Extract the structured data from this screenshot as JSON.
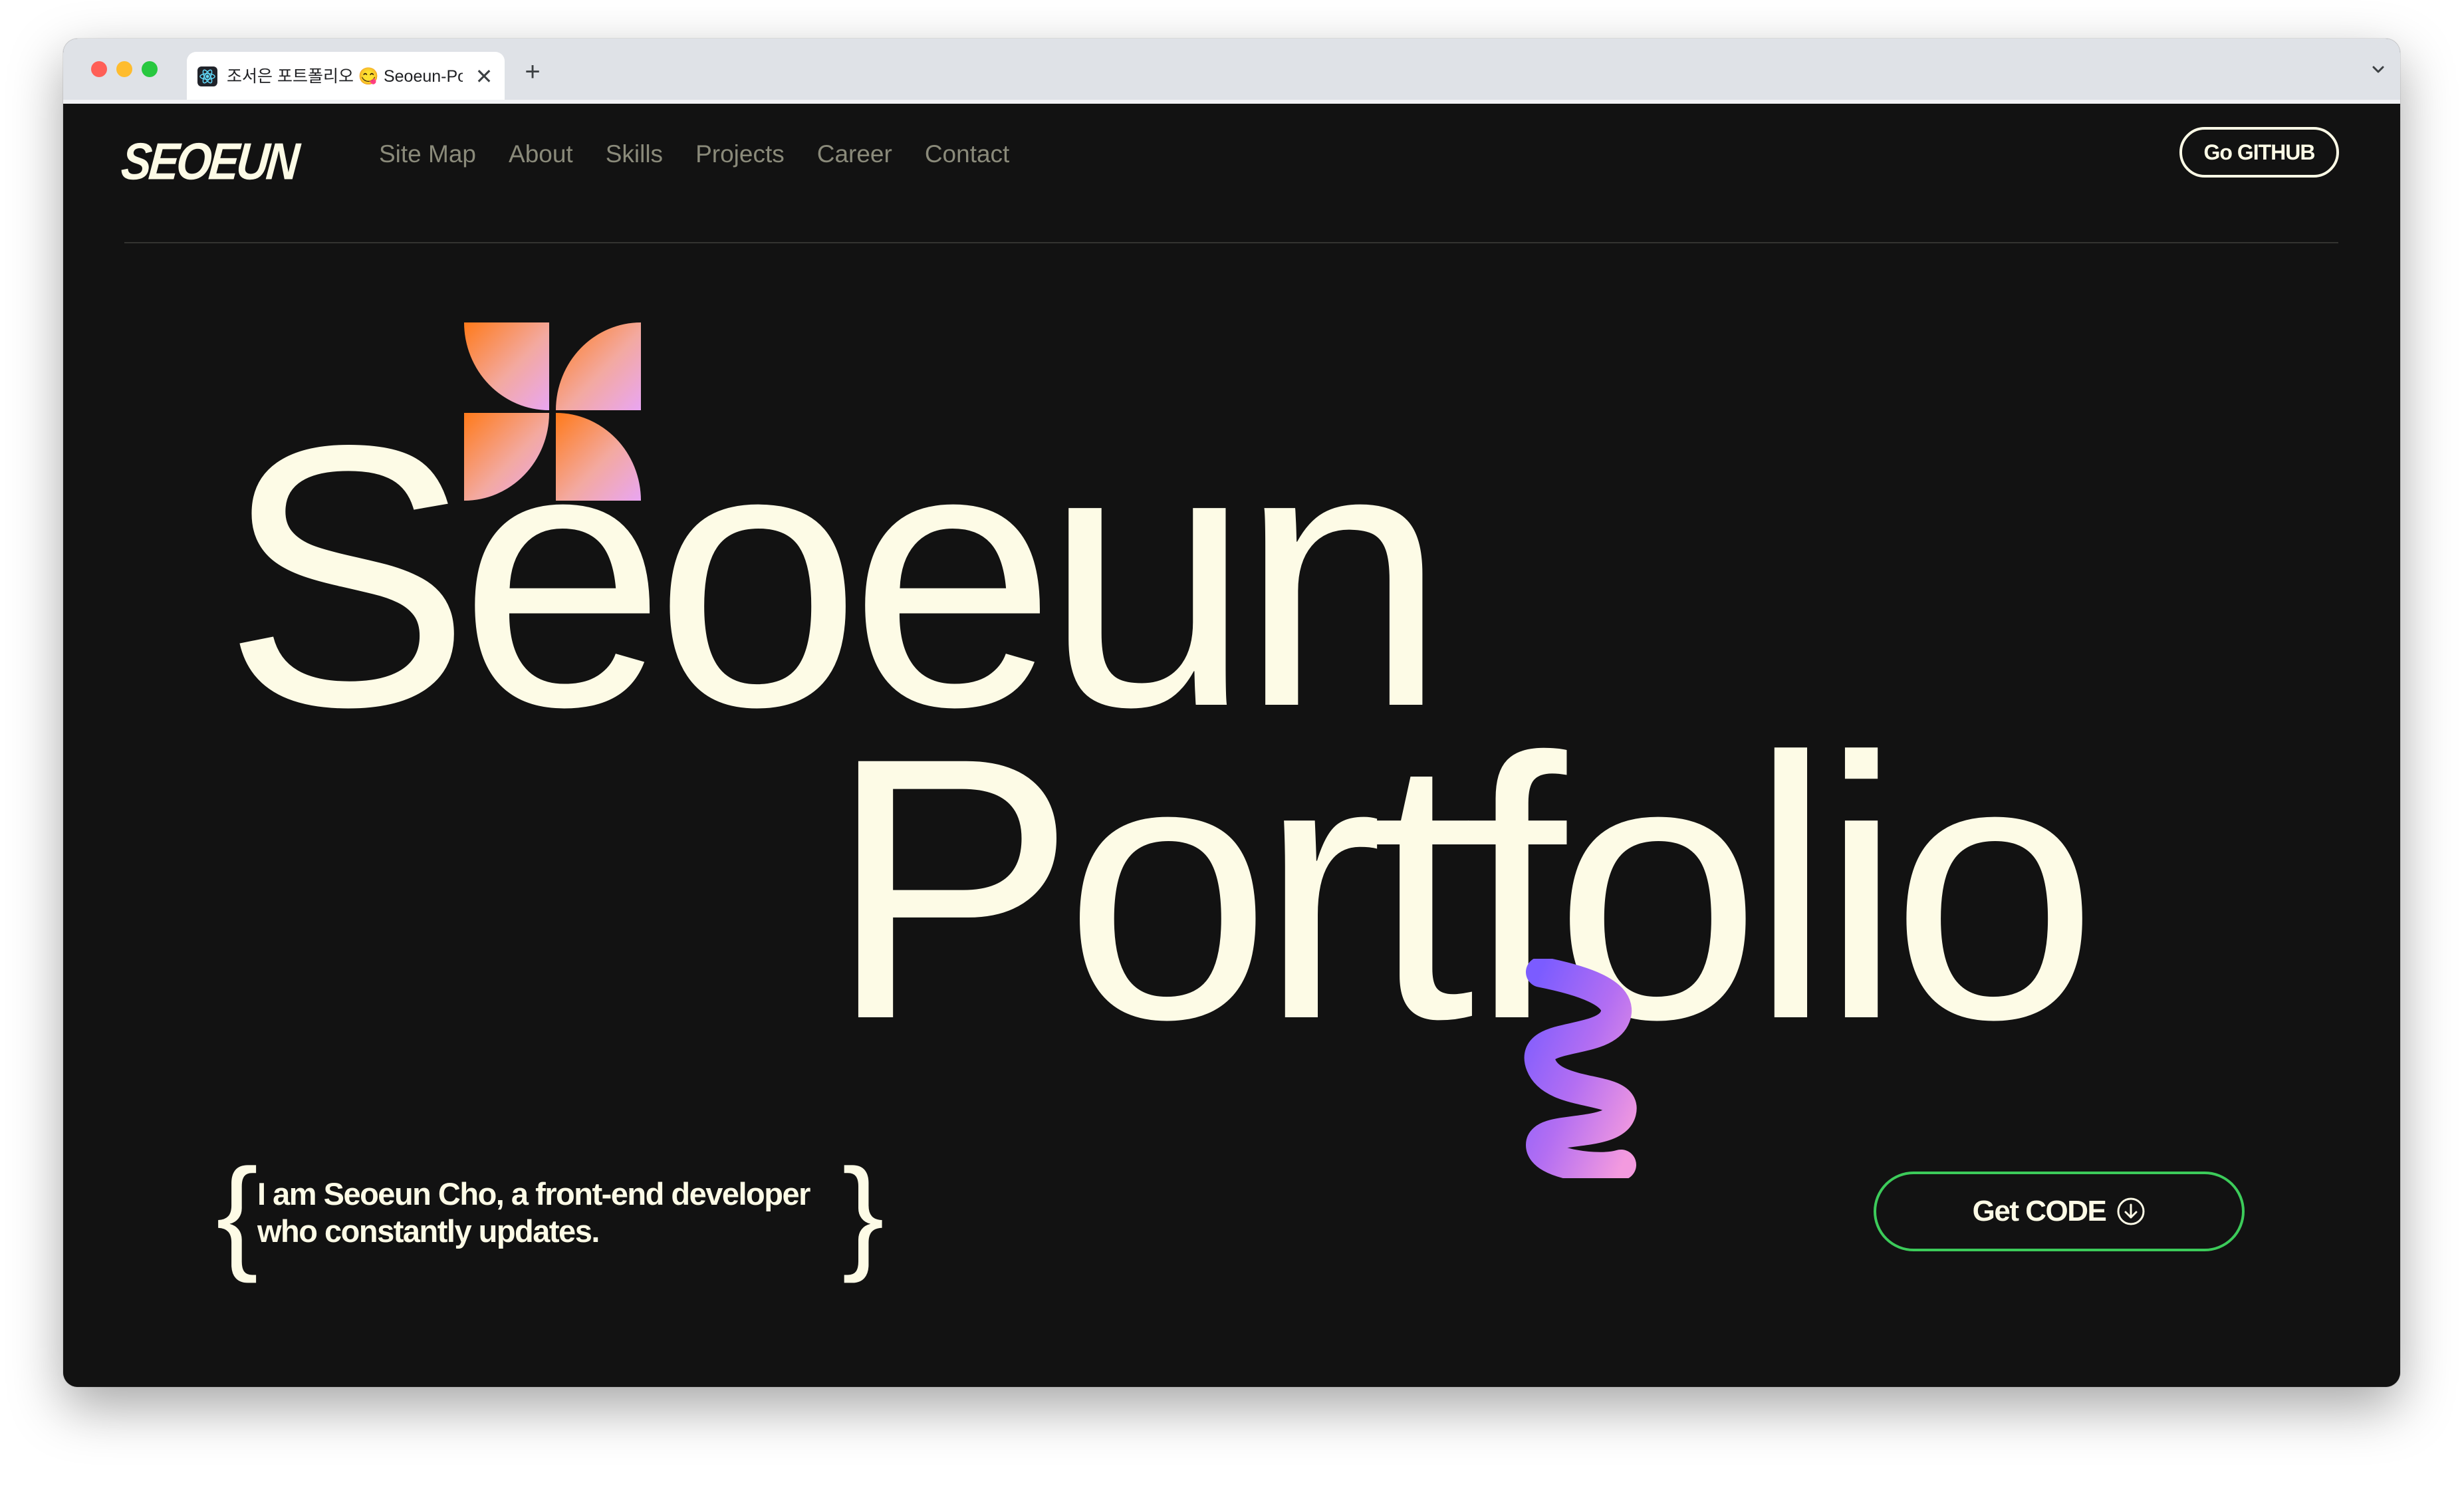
{
  "browser": {
    "tab_title": "조서은 포트폴리오 😋 Seoeun-Portfolio",
    "close_glyph": "✕",
    "new_tab_glyph": "+"
  },
  "header": {
    "logo": "SEOEUN",
    "nav": [
      "Site Map",
      "About",
      "Skills",
      "Projects",
      "Career",
      "Contact"
    ],
    "github_button": "Go GITHUB"
  },
  "hero": {
    "line1": "Seoeun",
    "line2": "Portfolio"
  },
  "intro": {
    "open_brace": "{",
    "text": "I am Seoeun Cho, a front-end developer who constantly updates.",
    "close_brace": "}"
  },
  "cta": {
    "label": "Get CODE",
    "icon": "arrow-down-circle-icon"
  },
  "colors": {
    "background": "#121212",
    "text": "#fdfbe6",
    "nav_text": "#8a8a7a",
    "cta_border": "#3ccb5a"
  }
}
